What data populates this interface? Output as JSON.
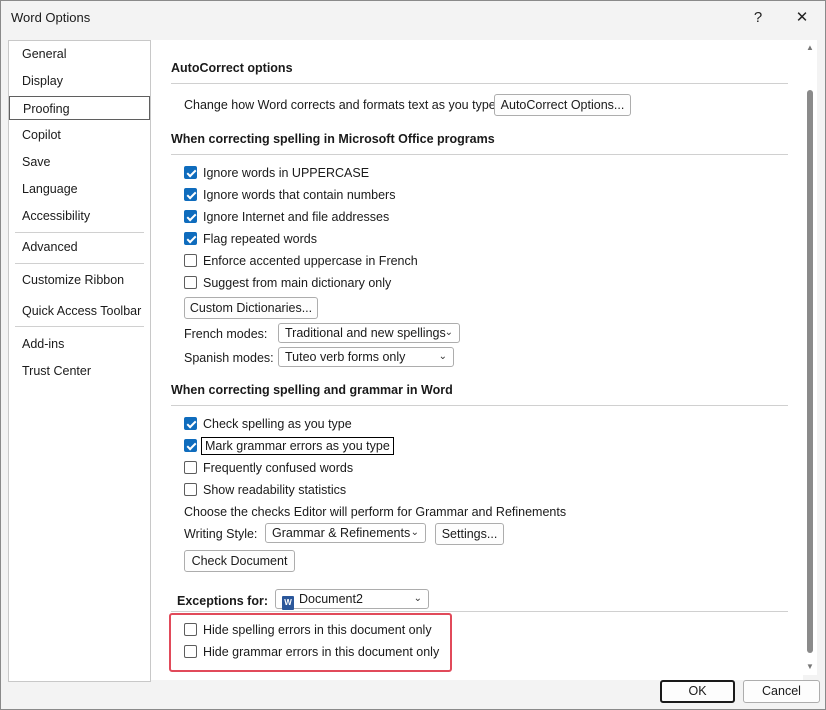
{
  "window": {
    "title": "Word Options",
    "help_label": "?",
    "close_label": "✕"
  },
  "sidebar": {
    "items": [
      {
        "label": "General"
      },
      {
        "label": "Display"
      },
      {
        "label": "Proofing"
      },
      {
        "label": "Copilot"
      },
      {
        "label": "Save"
      },
      {
        "label": "Language"
      },
      {
        "label": "Accessibility"
      },
      {
        "label": "Advanced"
      },
      {
        "label": "Customize Ribbon"
      },
      {
        "label": "Quick Access Toolbar"
      },
      {
        "label": "Add-ins"
      },
      {
        "label": "Trust Center"
      }
    ],
    "selected": "Proofing"
  },
  "autocorrect": {
    "title": "AutoCorrect options",
    "description": "Change how Word corrects and formats text as you type:",
    "button_label": "AutoCorrect Options..."
  },
  "office_spelling": {
    "title": "When correcting spelling in Microsoft Office programs",
    "options": [
      {
        "label": "Ignore words in UPPERCASE",
        "checked": true
      },
      {
        "label": "Ignore words that contain numbers",
        "checked": true
      },
      {
        "label": "Ignore Internet and file addresses",
        "checked": true
      },
      {
        "label": "Flag repeated words",
        "checked": true
      },
      {
        "label": "Enforce accented uppercase in French",
        "checked": false
      },
      {
        "label": "Suggest from main dictionary only",
        "checked": false
      }
    ],
    "custom_dictionaries_label": "Custom Dictionaries...",
    "french_modes_label": "French modes:",
    "french_modes_value": "Traditional and new spellings",
    "spanish_modes_label": "Spanish modes:",
    "spanish_modes_value": "Tuteo verb forms only"
  },
  "word_grammar": {
    "title": "When correcting spelling and grammar in Word",
    "options": [
      {
        "label": "Check spelling as you type",
        "checked": true
      },
      {
        "label": "Mark grammar errors as you type",
        "checked": true
      },
      {
        "label": "Frequently confused words",
        "checked": false
      },
      {
        "label": "Show readability statistics",
        "checked": false
      }
    ],
    "editor_description": "Choose the checks Editor will perform for Grammar and Refinements",
    "writing_style_label": "Writing Style:",
    "writing_style_value": "Grammar & Refinements",
    "settings_label": "Settings...",
    "check_document_label": "Check Document"
  },
  "exceptions": {
    "label": "Exceptions for:",
    "document_value": "Document2",
    "options": [
      {
        "label": "Hide spelling errors in this document only",
        "checked": false
      },
      {
        "label": "Hide grammar errors in this document only",
        "checked": false
      }
    ]
  },
  "footer": {
    "ok_label": "OK",
    "cancel_label": "Cancel"
  },
  "colors": {
    "checkbox_checked": "#0f6cbd",
    "highlight_border": "#e14a5a"
  }
}
